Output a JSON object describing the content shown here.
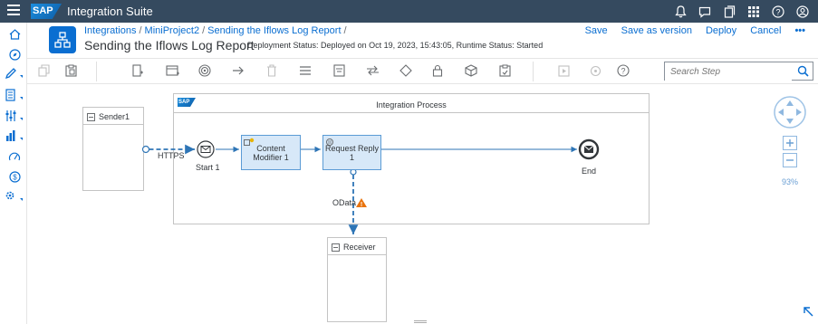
{
  "shell": {
    "logo": "SAP",
    "title": "Integration Suite"
  },
  "header": {
    "breadcrumbs": [
      "Integrations",
      "MiniProject2",
      "Sending the Iflows Log Report"
    ],
    "breadcrumb_separator": "/",
    "title": "Sending the Iflows Log Report",
    "status": "Deployment Status: Deployed on Oct 19, 2023, 15:43:05, Runtime Status: Started",
    "actions": {
      "save": "Save",
      "save_as_version": "Save as version",
      "deploy": "Deploy",
      "cancel": "Cancel",
      "more": "•••"
    }
  },
  "search": {
    "placeholder": "Search Step"
  },
  "diagram": {
    "sender_label": "Sender1",
    "receiver_label": "Receiver",
    "process_label": "Integration Process",
    "process_logo": "SAP",
    "start_label": "Start 1",
    "end_label": "End",
    "step1_label": "Content Modifier 1",
    "step2_label": "Request Reply 1",
    "https_label": "HTTPS",
    "odata_label": "OData",
    "zoom": "93%"
  },
  "colors": {
    "shell": "#354a5f",
    "accent": "#0a6ed1",
    "step_fill": "#d7e8f8",
    "flow": "#2e75b6",
    "warning": "#e9730c"
  }
}
